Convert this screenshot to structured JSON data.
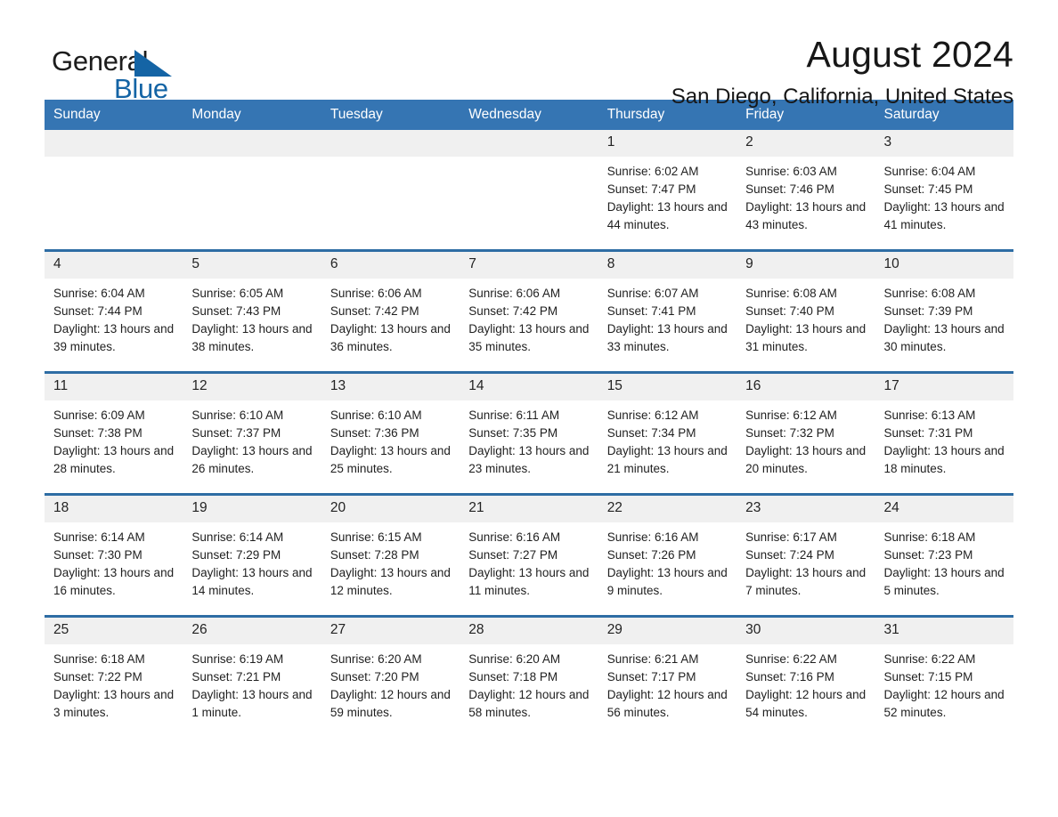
{
  "logo": {
    "text_general": "General",
    "text_blue": "Blue",
    "triangle_color": "#1464a5",
    "blue_color": "#1464a5"
  },
  "header": {
    "title": "August 2024",
    "subtitle": "San Diego, California, United States"
  },
  "theme": {
    "header_blue": "#3575b3",
    "row_border_blue": "#2e6da4",
    "daynum_band": "#f0f0f0"
  },
  "calendar": {
    "weekday_headers": [
      "Sunday",
      "Monday",
      "Tuesday",
      "Wednesday",
      "Thursday",
      "Friday",
      "Saturday"
    ],
    "weeks": [
      [
        {
          "day": "",
          "empty": true
        },
        {
          "day": "",
          "empty": true
        },
        {
          "day": "",
          "empty": true
        },
        {
          "day": "",
          "empty": true
        },
        {
          "day": "1",
          "sunrise": "Sunrise: 6:02 AM",
          "sunset": "Sunset: 7:47 PM",
          "daylight": "Daylight: 13 hours and 44 minutes."
        },
        {
          "day": "2",
          "sunrise": "Sunrise: 6:03 AM",
          "sunset": "Sunset: 7:46 PM",
          "daylight": "Daylight: 13 hours and 43 minutes."
        },
        {
          "day": "3",
          "sunrise": "Sunrise: 6:04 AM",
          "sunset": "Sunset: 7:45 PM",
          "daylight": "Daylight: 13 hours and 41 minutes."
        }
      ],
      [
        {
          "day": "4",
          "sunrise": "Sunrise: 6:04 AM",
          "sunset": "Sunset: 7:44 PM",
          "daylight": "Daylight: 13 hours and 39 minutes."
        },
        {
          "day": "5",
          "sunrise": "Sunrise: 6:05 AM",
          "sunset": "Sunset: 7:43 PM",
          "daylight": "Daylight: 13 hours and 38 minutes."
        },
        {
          "day": "6",
          "sunrise": "Sunrise: 6:06 AM",
          "sunset": "Sunset: 7:42 PM",
          "daylight": "Daylight: 13 hours and 36 minutes."
        },
        {
          "day": "7",
          "sunrise": "Sunrise: 6:06 AM",
          "sunset": "Sunset: 7:42 PM",
          "daylight": "Daylight: 13 hours and 35 minutes."
        },
        {
          "day": "8",
          "sunrise": "Sunrise: 6:07 AM",
          "sunset": "Sunset: 7:41 PM",
          "daylight": "Daylight: 13 hours and 33 minutes."
        },
        {
          "day": "9",
          "sunrise": "Sunrise: 6:08 AM",
          "sunset": "Sunset: 7:40 PM",
          "daylight": "Daylight: 13 hours and 31 minutes."
        },
        {
          "day": "10",
          "sunrise": "Sunrise: 6:08 AM",
          "sunset": "Sunset: 7:39 PM",
          "daylight": "Daylight: 13 hours and 30 minutes."
        }
      ],
      [
        {
          "day": "11",
          "sunrise": "Sunrise: 6:09 AM",
          "sunset": "Sunset: 7:38 PM",
          "daylight": "Daylight: 13 hours and 28 minutes."
        },
        {
          "day": "12",
          "sunrise": "Sunrise: 6:10 AM",
          "sunset": "Sunset: 7:37 PM",
          "daylight": "Daylight: 13 hours and 26 minutes."
        },
        {
          "day": "13",
          "sunrise": "Sunrise: 6:10 AM",
          "sunset": "Sunset: 7:36 PM",
          "daylight": "Daylight: 13 hours and 25 minutes."
        },
        {
          "day": "14",
          "sunrise": "Sunrise: 6:11 AM",
          "sunset": "Sunset: 7:35 PM",
          "daylight": "Daylight: 13 hours and 23 minutes."
        },
        {
          "day": "15",
          "sunrise": "Sunrise: 6:12 AM",
          "sunset": "Sunset: 7:34 PM",
          "daylight": "Daylight: 13 hours and 21 minutes."
        },
        {
          "day": "16",
          "sunrise": "Sunrise: 6:12 AM",
          "sunset": "Sunset: 7:32 PM",
          "daylight": "Daylight: 13 hours and 20 minutes."
        },
        {
          "day": "17",
          "sunrise": "Sunrise: 6:13 AM",
          "sunset": "Sunset: 7:31 PM",
          "daylight": "Daylight: 13 hours and 18 minutes."
        }
      ],
      [
        {
          "day": "18",
          "sunrise": "Sunrise: 6:14 AM",
          "sunset": "Sunset: 7:30 PM",
          "daylight": "Daylight: 13 hours and 16 minutes."
        },
        {
          "day": "19",
          "sunrise": "Sunrise: 6:14 AM",
          "sunset": "Sunset: 7:29 PM",
          "daylight": "Daylight: 13 hours and 14 minutes."
        },
        {
          "day": "20",
          "sunrise": "Sunrise: 6:15 AM",
          "sunset": "Sunset: 7:28 PM",
          "daylight": "Daylight: 13 hours and 12 minutes."
        },
        {
          "day": "21",
          "sunrise": "Sunrise: 6:16 AM",
          "sunset": "Sunset: 7:27 PM",
          "daylight": "Daylight: 13 hours and 11 minutes."
        },
        {
          "day": "22",
          "sunrise": "Sunrise: 6:16 AM",
          "sunset": "Sunset: 7:26 PM",
          "daylight": "Daylight: 13 hours and 9 minutes."
        },
        {
          "day": "23",
          "sunrise": "Sunrise: 6:17 AM",
          "sunset": "Sunset: 7:24 PM",
          "daylight": "Daylight: 13 hours and 7 minutes."
        },
        {
          "day": "24",
          "sunrise": "Sunrise: 6:18 AM",
          "sunset": "Sunset: 7:23 PM",
          "daylight": "Daylight: 13 hours and 5 minutes."
        }
      ],
      [
        {
          "day": "25",
          "sunrise": "Sunrise: 6:18 AM",
          "sunset": "Sunset: 7:22 PM",
          "daylight": "Daylight: 13 hours and 3 minutes."
        },
        {
          "day": "26",
          "sunrise": "Sunrise: 6:19 AM",
          "sunset": "Sunset: 7:21 PM",
          "daylight": "Daylight: 13 hours and 1 minute."
        },
        {
          "day": "27",
          "sunrise": "Sunrise: 6:20 AM",
          "sunset": "Sunset: 7:20 PM",
          "daylight": "Daylight: 12 hours and 59 minutes."
        },
        {
          "day": "28",
          "sunrise": "Sunrise: 6:20 AM",
          "sunset": "Sunset: 7:18 PM",
          "daylight": "Daylight: 12 hours and 58 minutes."
        },
        {
          "day": "29",
          "sunrise": "Sunrise: 6:21 AM",
          "sunset": "Sunset: 7:17 PM",
          "daylight": "Daylight: 12 hours and 56 minutes."
        },
        {
          "day": "30",
          "sunrise": "Sunrise: 6:22 AM",
          "sunset": "Sunset: 7:16 PM",
          "daylight": "Daylight: 12 hours and 54 minutes."
        },
        {
          "day": "31",
          "sunrise": "Sunrise: 6:22 AM",
          "sunset": "Sunset: 7:15 PM",
          "daylight": "Daylight: 12 hours and 52 minutes."
        }
      ]
    ]
  }
}
